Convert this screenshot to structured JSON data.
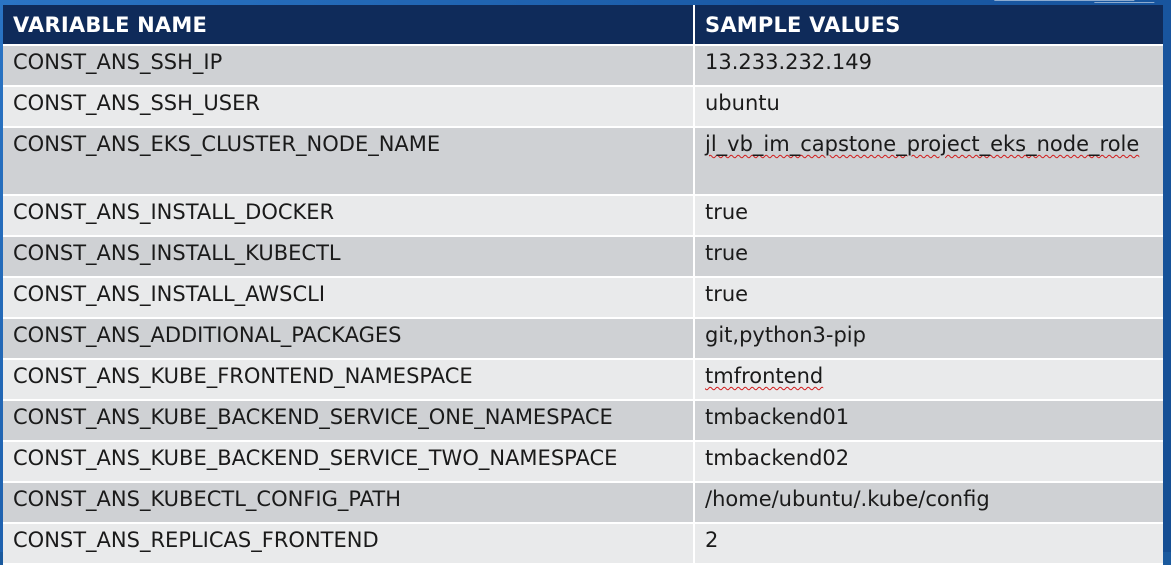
{
  "table": {
    "headers": [
      "VARIABLE NAME",
      "SAMPLE VALUES"
    ],
    "rows": [
      {
        "name": "CONST_ANS_SSH_IP",
        "value": "13.233.232.149"
      },
      {
        "name": "CONST_ANS_SSH_USER",
        "value": "ubuntu"
      },
      {
        "name": "CONST_ANS_EKS_CLUSTER_NODE_NAME",
        "value": "jl_vb_im_capstone_project_eks_node_role"
      },
      {
        "name": "CONST_ANS_INSTALL_DOCKER",
        "value": "true"
      },
      {
        "name": "CONST_ANS_INSTALL_KUBECTL",
        "value": "true"
      },
      {
        "name": "CONST_ANS_INSTALL_AWSCLI",
        "value": "true"
      },
      {
        "name": "CONST_ANS_ADDITIONAL_PACKAGES",
        "value": "git,python3-pip"
      },
      {
        "name": "CONST_ANS_KUBE_FRONTEND_NAMESPACE",
        "value": "tmfrontend"
      },
      {
        "name": "CONST_ANS_KUBE_BACKEND_SERVICE_ONE_NAMESPACE",
        "value": "tmbackend01"
      },
      {
        "name": "CONST_ANS_KUBE_BACKEND_SERVICE_TWO_NAMESPACE",
        "value": "tmbackend02"
      },
      {
        "name": "CONST_ANS_KUBECTL_CONFIG_PATH",
        "value": "/home/ubuntu/.kube/config"
      },
      {
        "name": "CONST_ANS_REPLICAS_FRONTEND",
        "value": "2"
      }
    ]
  }
}
